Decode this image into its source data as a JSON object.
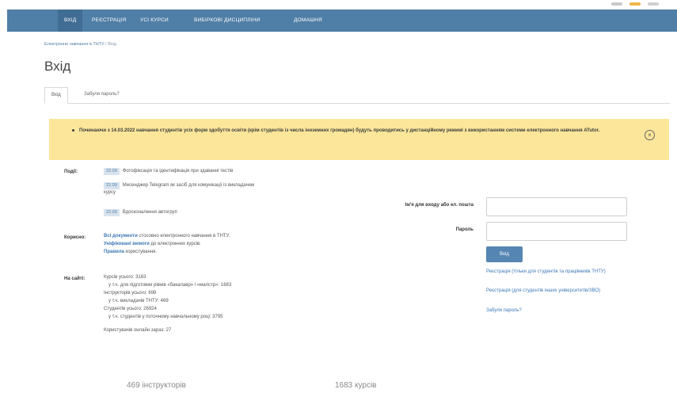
{
  "nav": {
    "items": [
      {
        "label": "ВХІД",
        "name": "nav-login"
      },
      {
        "label": "РЕЄСТРАЦІЯ",
        "name": "nav-registration"
      },
      {
        "label": "УСІ КУРСИ",
        "name": "nav-all-courses"
      },
      {
        "label": "ВИБІРКОВІ ДИСЦИПЛІНИ",
        "name": "nav-electives"
      },
      {
        "label": "ДОМАШНЯ",
        "name": "nav-home"
      }
    ]
  },
  "breadcrumb": {
    "root": "Електронне навчання в ТНТУ",
    "separator": "/",
    "current": "Вхід"
  },
  "page_title": "Вхід",
  "tabs": [
    {
      "label": "Вхід",
      "active": true
    },
    {
      "label": "Забули пароль?",
      "active": false
    }
  ],
  "alert": {
    "message": "Починаючи з 14.03.2022 навчання студентів усіх форм здобуття освіти (крім студентів із числа іноземних громадян) будуть проводитись у дистанційному режимі з використанням системи електронного навчання ATutor.",
    "close_icon": "close-circle-icon"
  },
  "events": {
    "label": "Події:",
    "items": [
      {
        "date": "22.09",
        "text": "Фотофіксація та ідентифікація при здаванні тестів"
      },
      {
        "date": "22.09",
        "text": "Месенджер Telegram як засіб для комунікації із викладачем курсу"
      },
      {
        "date": "22.09",
        "text": "Вдосконалення автогруп"
      }
    ]
  },
  "useful": {
    "label": "Корисно:",
    "lines": [
      {
        "link": "Всі документи",
        "text": " стосовно електронного навчання в ТНТУ."
      },
      {
        "link": "Уніфіковані вимоги",
        "text": " до електронних курсів."
      },
      {
        "link": "Правила",
        "text": " користування."
      }
    ]
  },
  "site": {
    "label": "На сайті:",
    "lines": [
      "Курсів усього: 3163",
      "у т.ч. для підготовки рівнів «бакалавр» і «магістр»: 1683",
      "Інструкторів усього: 698",
      "у т.ч. викладачів ТНТУ: 469",
      "Студентів усього: 26924",
      "у т.ч. студентів у поточному навчальному році: 3795",
      "Користувачів онлайн зараз: 27"
    ]
  },
  "login_form": {
    "username_label": "Ім'я для входу або ел. пошта",
    "password_label": "Пароль",
    "username_value": "",
    "password_value": "",
    "submit_label": "Вхід",
    "links": [
      "Реєстрація (тільки для студентів та працівників ТНТУ)",
      "Реєстрація (для студентів інших університетів/ЗВО)",
      "Забули пароль?"
    ]
  },
  "stats": {
    "instructors": "469 інструкторів",
    "courses": "1683 курсів"
  },
  "colors": {
    "navbar": "#4f7ea6",
    "alert": "#fbe69a",
    "link": "#3c78b5"
  }
}
